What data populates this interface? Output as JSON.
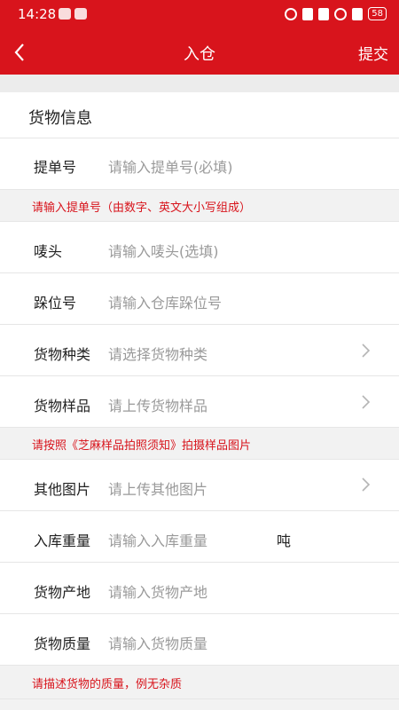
{
  "status_bar": {
    "time": "14:28",
    "battery": "58"
  },
  "navbar": {
    "title": "入仓",
    "submit_label": "提交"
  },
  "section": {
    "title": "货物信息"
  },
  "fields": {
    "bill_no": {
      "label": "提单号",
      "placeholder": "请输入提单号(必填)"
    },
    "mark": {
      "label": "唛头",
      "placeholder": "请输入唛头(选填)"
    },
    "location": {
      "label": "跺位号",
      "placeholder": "请输入仓库跺位号"
    },
    "category": {
      "label": "货物种类",
      "placeholder": "请选择货物种类"
    },
    "sample": {
      "label": "货物样品",
      "placeholder": "请上传货物样品"
    },
    "other_images": {
      "label": "其他图片",
      "placeholder": "请上传其他图片"
    },
    "weight": {
      "label": "入库重量",
      "placeholder": "请输入入库重量",
      "unit": "吨"
    },
    "origin": {
      "label": "货物产地",
      "placeholder": "请输入货物产地"
    },
    "quality": {
      "label": "货物质量",
      "placeholder": "请输入货物质量"
    }
  },
  "hints": {
    "bill_no": "请输入提单号（由数字、英文大小写组成）",
    "sample": "请按照《芝麻样品拍照须知》拍摄样品图片",
    "quality": "请描述货物的质量，例无杂质"
  },
  "colors": {
    "brand": "#d8141c",
    "hint": "#d8141c",
    "placeholder": "#9a9a9a"
  },
  "icons": [
    "wechat-icon",
    "app-icon",
    "eye-icon",
    "nfc-icon",
    "bluetooth-icon",
    "wifi-icon",
    "alert-icon",
    "battery-icon",
    "back-chevron-icon",
    "chevron-right-icon"
  ]
}
